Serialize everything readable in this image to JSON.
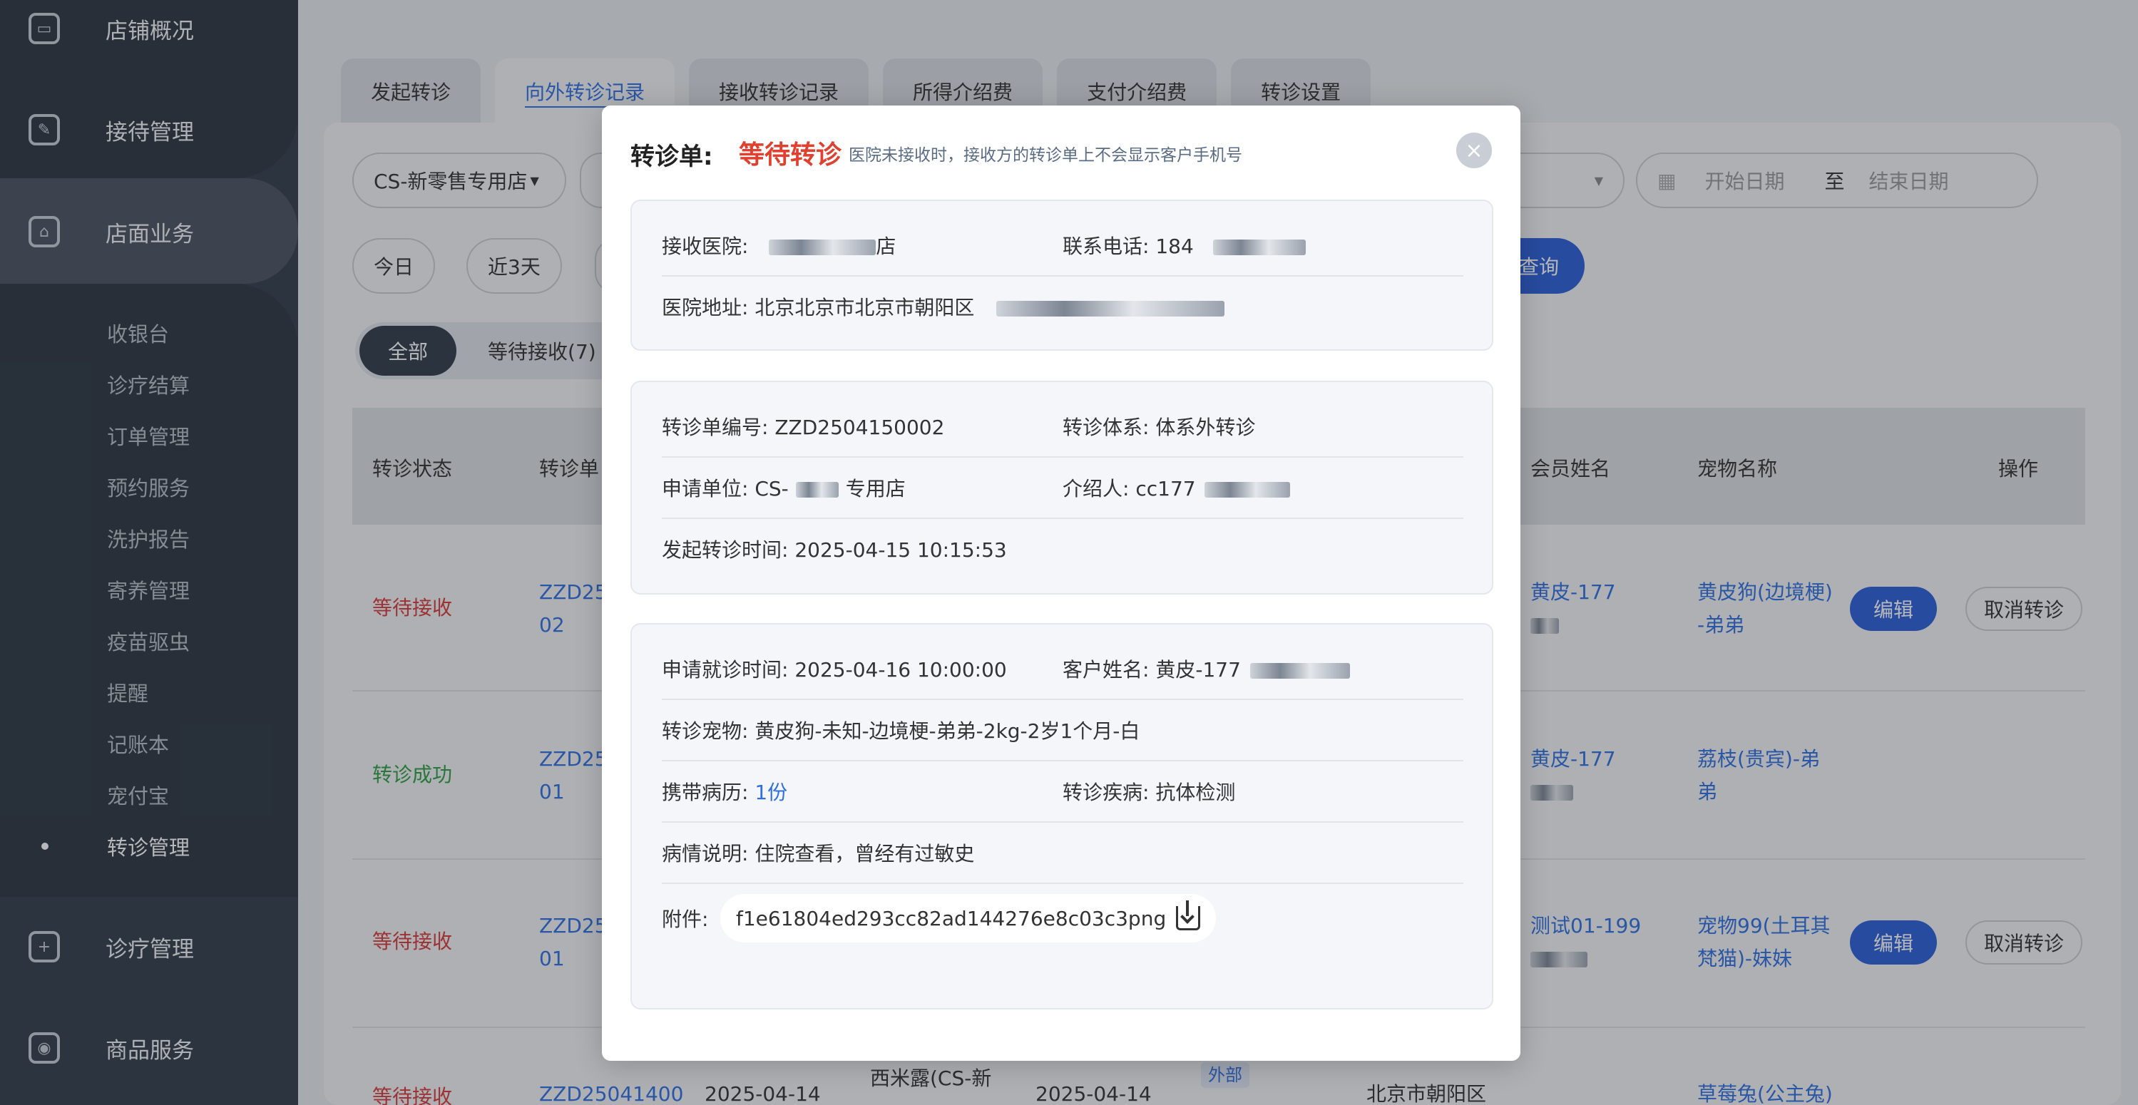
{
  "sidebar": {
    "main_items": [
      {
        "label": "店铺概况",
        "icon": "dashboard-icon"
      },
      {
        "label": "接待管理",
        "icon": "clipboard-icon"
      },
      {
        "label": "店面业务",
        "icon": "store-icon"
      },
      {
        "label": "诊疗管理",
        "icon": "medical-kit-icon"
      },
      {
        "label": "商品服务",
        "icon": "shopping-bag-icon"
      }
    ],
    "sub_items": [
      "收银台",
      "诊疗结算",
      "订单管理",
      "预约服务",
      "洗护报告",
      "寄养管理",
      "疫苗驱虫",
      "提醒",
      "记账本",
      "宠付宝",
      "转诊管理"
    ]
  },
  "tabs": [
    "发起转诊",
    "向外转诊记录",
    "接收转诊记录",
    "所得介绍费",
    "支付介绍费",
    "转诊设置"
  ],
  "filters": {
    "store": "CS-新零售专用店",
    "start_date": "开始日期",
    "to": "至",
    "end_date": "结束日期",
    "today": "今日",
    "last3": "近3天",
    "query": "查询"
  },
  "segments": {
    "all": "全部",
    "pending": "等待接收(7)"
  },
  "table": {
    "headers": [
      "转诊状态",
      "转诊单",
      "会员姓名",
      "宠物名称",
      "操作"
    ],
    "rows": [
      {
        "status": "等待接收",
        "code": "ZZD25\n02",
        "member": "黄皮-177",
        "pet": "黄皮狗(边境梗)\n-弟弟"
      },
      {
        "status": "转诊成功",
        "code": "ZZD25\n01",
        "member": "黄皮-177",
        "pet": "荔枝(贵宾)-弟\n弟"
      },
      {
        "status": "等待接收",
        "code": "ZZD25\n01",
        "member": "测试01-199",
        "pet": "宠物99(土耳其\n梵猫)-妹妹"
      },
      {
        "status": "等待接收",
        "code": "ZZD25041400",
        "date": "2025-04-14",
        "from": "西米露(CS-新",
        "date2": "2025-04-14",
        "tag": "外部",
        "addr": "北京市朝阳区",
        "pet": "草莓兔(公主兔)"
      }
    ],
    "edit": "编辑",
    "cancel": "取消转诊"
  },
  "modal": {
    "title": "转诊单:",
    "status": "等待转诊",
    "note": "医院未接收时，接收方的转诊单上不会显示客户手机号",
    "close": "×",
    "hospital": {
      "receive_label": "接收医院:",
      "receive_value": "店",
      "phone_label": "联系电话:",
      "phone_value": "184",
      "addr_label": "医院地址:",
      "addr_value": "北京北京市北京市朝阳区"
    },
    "order": {
      "code_label": "转诊单编号:",
      "code_value": "ZZD2504150002",
      "system_label": "转诊体系:",
      "system_value": "体系外转诊",
      "applicant_label": "申请单位:",
      "applicant_value": "CS-",
      "applicant_suffix": "专用店",
      "referrer_label": "介绍人:",
      "referrer_value": "cc177",
      "time_label": "发起转诊时间:",
      "time_value": "2025-04-15 10:15:53"
    },
    "visit": {
      "visit_time_label": "申请就诊时间:",
      "visit_time_value": "2025-04-16 10:00:00",
      "customer_label": "客户姓名:",
      "customer_value": "黄皮-177",
      "pet_label": "转诊宠物:",
      "pet_value": "黄皮狗-未知-边境梗-弟弟-2kg-2岁1个月-白",
      "history_label": "携带病历:",
      "history_value": "1份",
      "disease_label": "转诊疾病:",
      "disease_value": "抗体检测",
      "desc_label": "病情说明:",
      "desc_value": "住院查看，曾经有过敏史",
      "attach_label": "附件:",
      "attach_value": "f1e61804ed293cc82ad144276e8c03c3png"
    }
  }
}
